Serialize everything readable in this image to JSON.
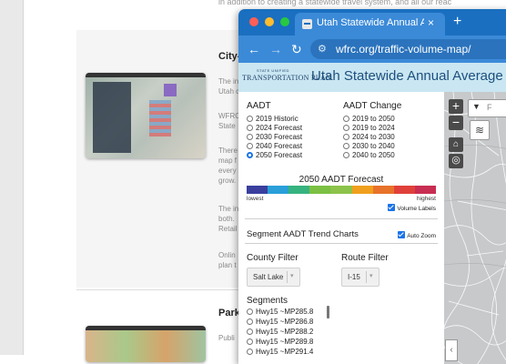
{
  "background_page": {
    "intro_text": "in addition to creating a statewide travel system, and all our reac",
    "section1": {
      "heading": "City-",
      "p1": [
        "The in",
        "Utah c"
      ],
      "p2": [
        "WFRC",
        "State"
      ],
      "p3": [
        "There",
        "map f",
        "every",
        "grow."
      ],
      "p4": [
        "The in",
        "both.",
        "Retail"
      ],
      "p5": [
        "Onlin",
        "plan t"
      ]
    },
    "section2": {
      "heading": "Park",
      "p1": "Publi"
    }
  },
  "browser": {
    "tab_title": "Utah Statewide Annual Averag",
    "tab_close": "×",
    "new_tab": "+",
    "url": "wfrc.org/traffic-volume-map/",
    "colors": {
      "tabbar": "#1a6fc0",
      "toolbar": "#3b8ad8"
    }
  },
  "app": {
    "logo_small": "STATE UNIFIED",
    "logo_big": "TRANSPORTATION PLAN",
    "title": "Utah Statewide Annual Average Daily",
    "aadt": {
      "heading": "AADT",
      "options": [
        "2019 Historic",
        "2024 Forecast",
        "2030 Forecast",
        "2040 Forecast",
        "2050 Forecast"
      ],
      "selected": "2050 Forecast"
    },
    "aadt_change": {
      "heading": "AADT Change",
      "options": [
        "2019 to 2050",
        "2019 to 2024",
        "2024 to 2030",
        "2030 to 2040",
        "2040 to 2050"
      ]
    },
    "legend": {
      "title": "2050 AADT Forecast",
      "low_label": "lowest",
      "high_label": "highest",
      "ramp_colors": [
        "#3a3f9e",
        "#2a9fd9",
        "#36b37e",
        "#7bc043",
        "#8cc34a",
        "#f0a01e",
        "#e8722a",
        "#e0403a",
        "#c82e52"
      ],
      "volume_labels": "Volume Labels",
      "volume_labels_checked": true
    },
    "trend": {
      "heading": "Segment AADT Trend Charts",
      "auto_zoom": "Auto Zoom",
      "auto_zoom_checked": true
    },
    "county_filter": {
      "label": "County Filter",
      "value": "Salt Lake"
    },
    "route_filter": {
      "label": "Route Filter",
      "value": "I-15"
    },
    "segments": {
      "label": "Segments",
      "items": [
        "Hwy15 ~MP285.8",
        "Hwy15 ~MP286.8",
        "Hwy15 ~MP288.2",
        "Hwy15 ~MP289.8",
        "Hwy15 ~MP291.4"
      ]
    },
    "map": {
      "zoom_in": "+",
      "zoom_out": "−",
      "search_placeholder": "F"
    }
  }
}
